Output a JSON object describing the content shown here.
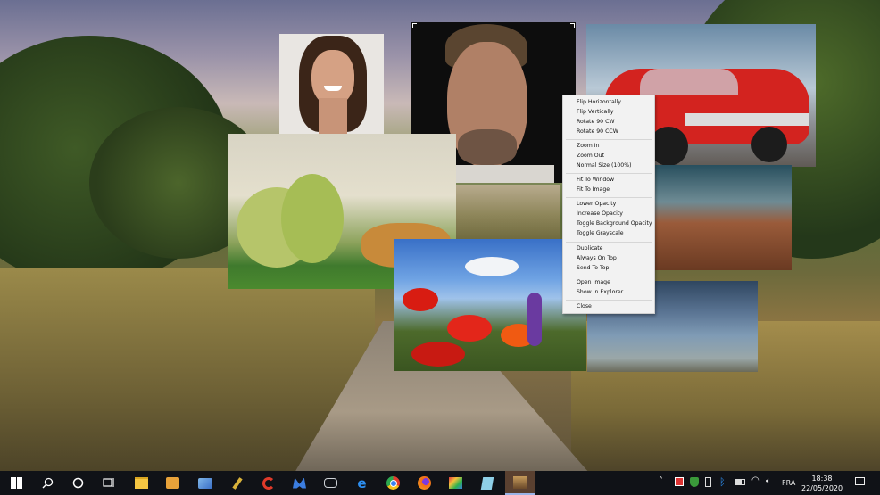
{
  "context_menu": {
    "items": [
      {
        "label": "Flip Horizontally"
      },
      {
        "label": "Flip Vertically"
      },
      {
        "label": "Rotate 90 CW"
      },
      {
        "label": "Rotate 90 CCW"
      },
      {
        "label": "Zoom In"
      },
      {
        "label": "Zoom Out"
      },
      {
        "label": "Normal Size (100%)"
      },
      {
        "label": "Fit To Window"
      },
      {
        "label": "Fit To Image"
      },
      {
        "label": "Lower Opacity"
      },
      {
        "label": "Increase Opacity"
      },
      {
        "label": "Toggle Background Opacity"
      },
      {
        "label": "Toggle Grayscale"
      },
      {
        "label": "Duplicate"
      },
      {
        "label": "Always On Top"
      },
      {
        "label": "Send To Top"
      },
      {
        "label": "Open Image"
      },
      {
        "label": "Show In Explorer"
      },
      {
        "label": "Close"
      }
    ]
  },
  "taskbar": {
    "apps": [
      {
        "icon": "windows-start-icon"
      },
      {
        "icon": "search-icon"
      },
      {
        "icon": "cortana-icon"
      },
      {
        "icon": "task-view-icon"
      },
      {
        "icon": "file-explorer-icon"
      },
      {
        "icon": "media-player-icon"
      },
      {
        "icon": "photo-app-icon"
      },
      {
        "icon": "cleaner-icon"
      },
      {
        "icon": "ccleaner-icon"
      },
      {
        "icon": "malwarebytes-icon"
      },
      {
        "icon": "camera-app-icon"
      },
      {
        "icon": "edge-icon"
      },
      {
        "icon": "chrome-icon"
      },
      {
        "icon": "firefox-icon"
      },
      {
        "icon": "paint-icon"
      },
      {
        "icon": "notepad-icon"
      },
      {
        "icon": "image-viewer-icon"
      }
    ],
    "tray": {
      "language": "FRA",
      "time": "18:38",
      "date": "22/05/2020"
    }
  },
  "colors": {
    "taskbar": "#101217",
    "menu_bg": "#f2f2f2",
    "active_app": "#5a4030"
  }
}
